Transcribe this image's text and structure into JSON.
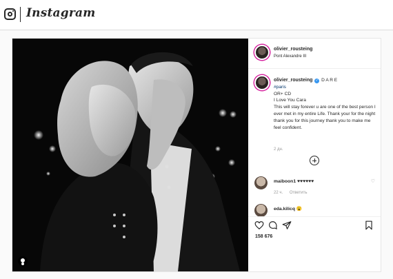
{
  "header": {
    "brand": "Instagram"
  },
  "post": {
    "username": "olivier_rousteing",
    "location": "Pont Alexandre III",
    "caption": {
      "username": "olivier_rousteing",
      "title": "D A R E",
      "hashtag": "#paris",
      "lines": [
        "OR+ CD",
        "I Love You Cara",
        "This will stay forever u are one of the best person I ever met in my entire Life. Thank your for the night",
        "thank you for this journey thank you to make me feel confident."
      ]
    },
    "time_ago": "2 дн.",
    "comments": [
      {
        "username": "maiboon1",
        "text": "♥♥♥♥♥♥",
        "time": "22 ч.",
        "reply": "Ответить"
      },
      {
        "username": "eda.kilicq",
        "text": "😮"
      }
    ],
    "likes": "158 676"
  },
  "icons": {
    "brand": "instagram-glyph-icon",
    "verified": "verified-badge-icon",
    "like": "heart-icon",
    "comment": "comment-icon",
    "share": "share-icon",
    "save": "bookmark-icon",
    "more": "plus-circle-icon",
    "tag": "user-tag-icon"
  }
}
